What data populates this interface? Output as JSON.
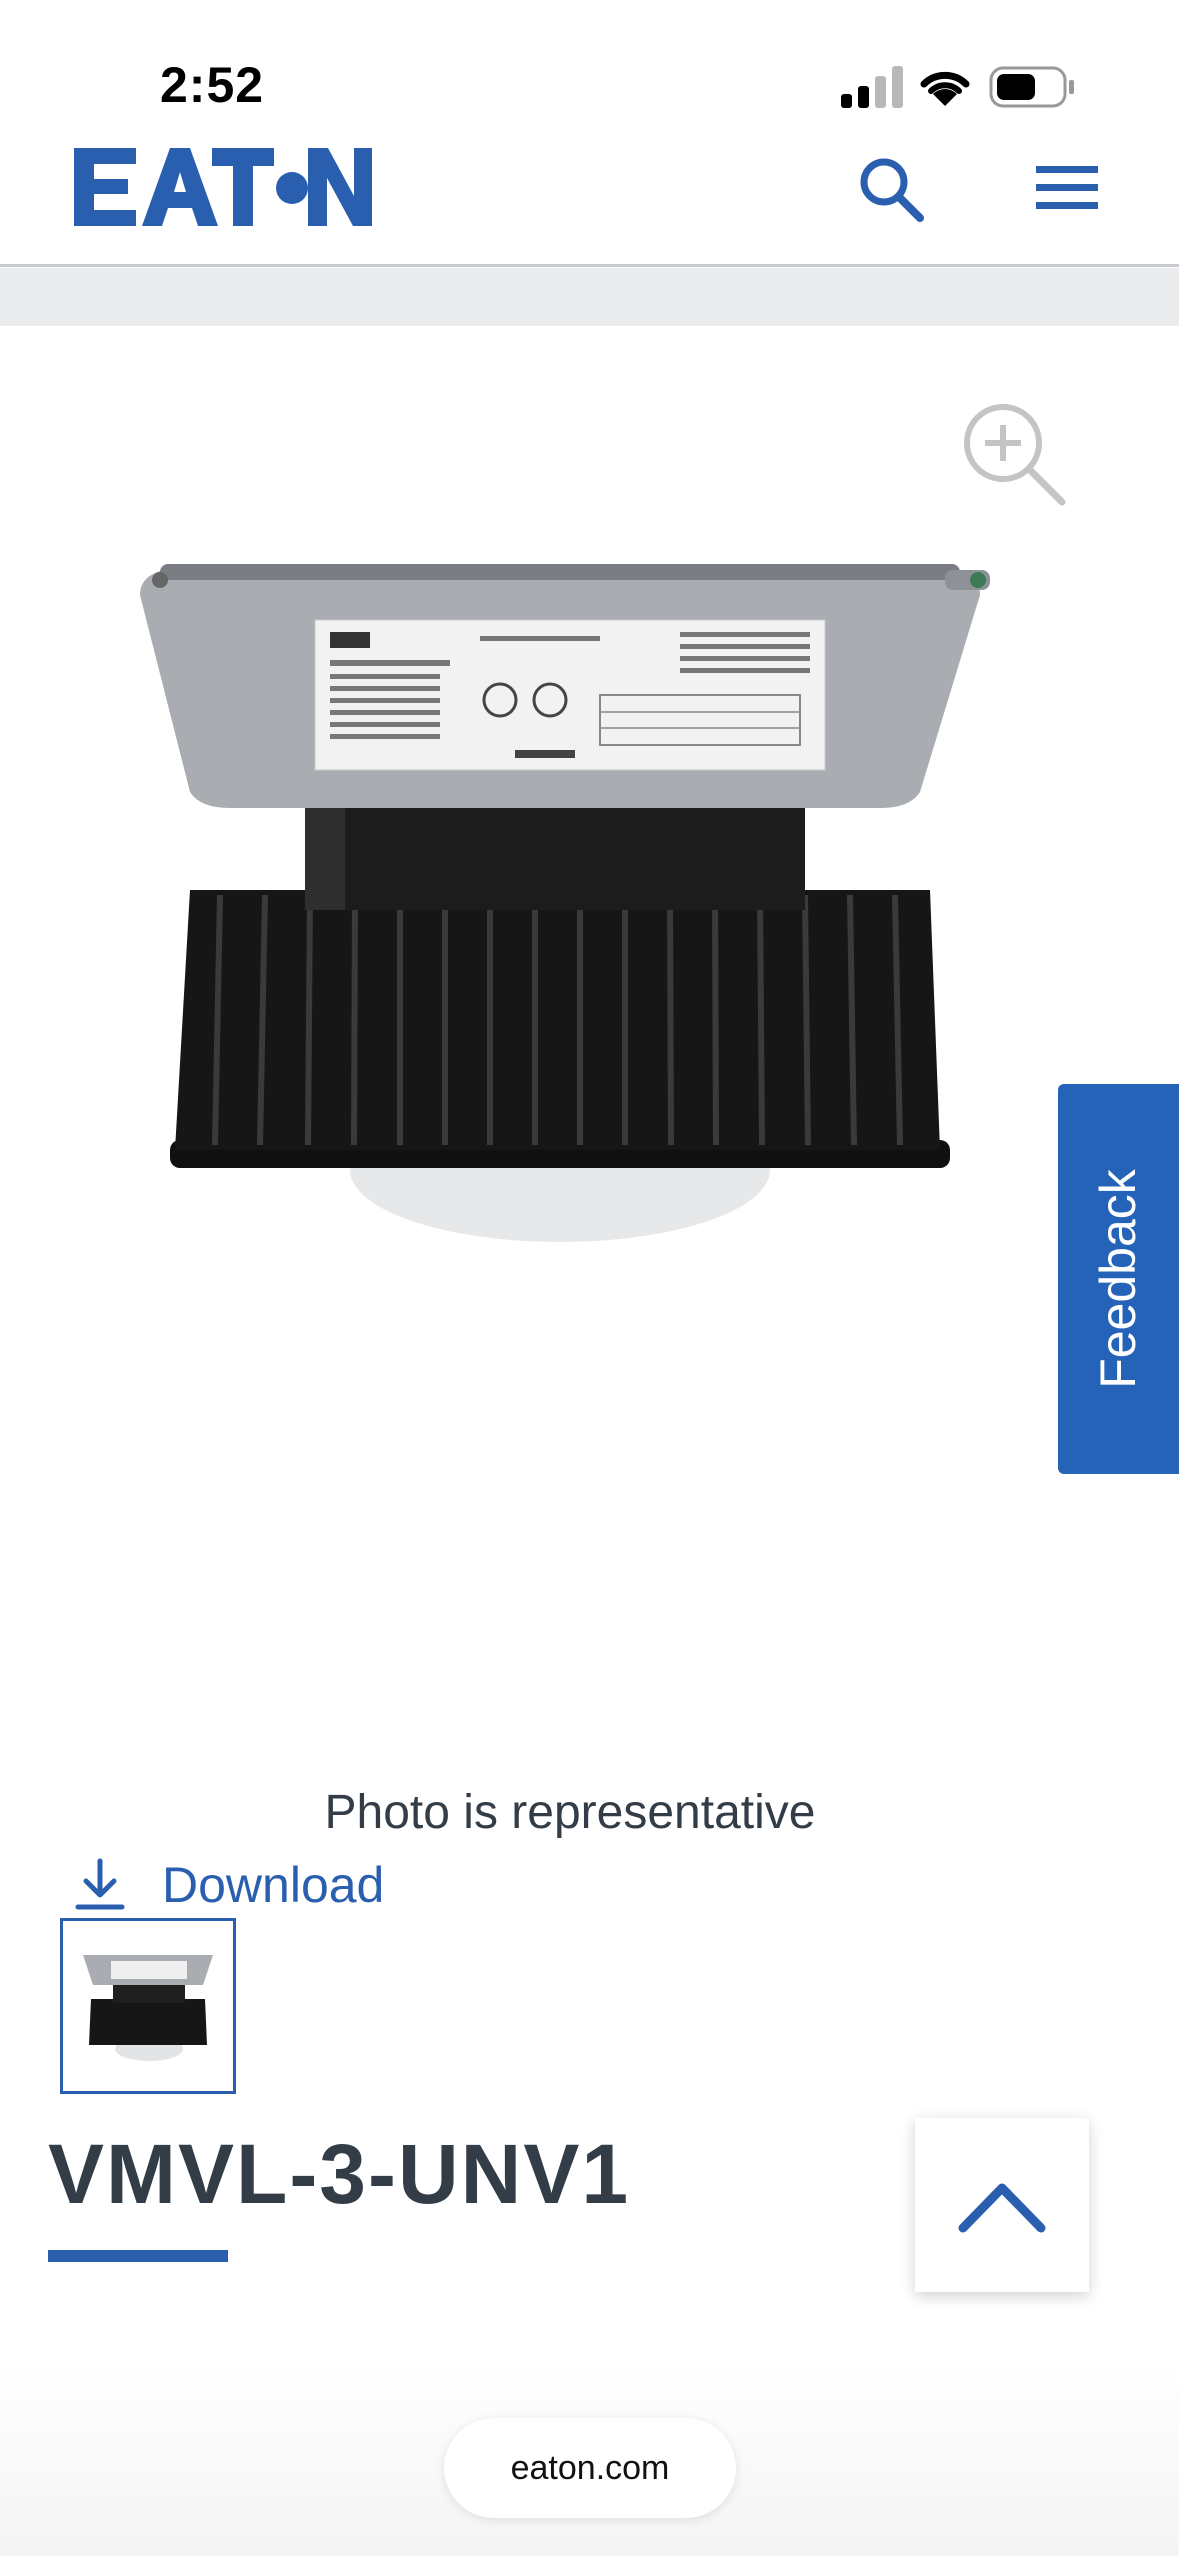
{
  "status_bar": {
    "time": "2:52"
  },
  "header": {
    "logo_text": "EATON",
    "brand_color": "#2a5fb0",
    "icons": [
      "search-icon",
      "hamburger-menu-icon"
    ]
  },
  "gallery": {
    "zoom_icon": "zoom-in-icon",
    "caption": "Photo is representative",
    "download_label": "Download",
    "download_icon": "download-icon",
    "thumbnails_count": 1
  },
  "feedback": {
    "label": "Feedback",
    "color": "#2563b9"
  },
  "product": {
    "title": "VMVL-3-UNV1"
  },
  "back_to_top": {
    "icon": "chevron-up-icon"
  },
  "browser": {
    "url": "eaton.com"
  }
}
